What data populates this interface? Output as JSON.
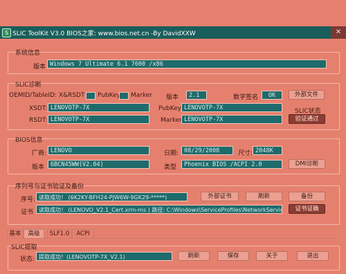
{
  "window": {
    "title": "SLIC ToolKit V3.0     BIOS之家: www.bios.net.cn  -By DavidXXW",
    "icon_text": "S",
    "close": "✕"
  },
  "system": {
    "group_title": "系统信息",
    "version_label": "版本",
    "version_value": "Windows 7 Ultimate 6.1 7600 /x86"
  },
  "slic": {
    "group_title": "SLIC诊断",
    "demid_label": "OEMID/TableID: X&RSDT",
    "pubkey_label": "PubKey",
    "marker_label": "Marker",
    "version_label": "版本",
    "version_value": "2.1",
    "signature_label": "数字签名",
    "signature_value": "OK",
    "external_file_button": "外部文件",
    "xsdt_label": "XSDT:",
    "xsdt_value": "LENOVOTP-7X",
    "pubkey2_label": "PubKey:",
    "pubkey2_value": "LENOVOTP-7X",
    "rsdt_label": "RSDT:",
    "rsdt_value": "LENOVOTP-7X",
    "marker2_label": "Marker:",
    "marker2_value": "LENOVOTP-7X",
    "status_label": "SLIC状态",
    "status_button": "验证通过"
  },
  "bios": {
    "group_title": "BIOS信息",
    "vendor_label": "厂商:",
    "vendor_value": "LENOVO",
    "date_label": "日期:",
    "date_value": "08/29/2008",
    "size_label": "尺寸:",
    "size_value": "2048K",
    "version_label": "版本",
    "version_value": "6BCN45WW(V2.04)",
    "type_label": "类型",
    "type_value": "Phoenix BIOS /ACPI 2.0",
    "dmi_button": "DMI诊断"
  },
  "serial": {
    "group_title": "序列号与证书验证及备份",
    "serial_label": "序号:",
    "serial_value": "读取成功！ (6K2KY-BFH24-PJW6W-9GK29-*****)",
    "external_cert_button": "外部证书",
    "refresh_button": "刷新",
    "backup_button": "备份",
    "cert_label": "证书",
    "cert_value": "读取成功！ (LENOVO_V2.1_Cert.xrm-ms )    路径: C:\\Windows\\ServiceProfiles\\NetworkService\\A",
    "cert_verify_button": "证书证确"
  },
  "tabs": [
    "基本",
    "高级",
    "SLF1.0",
    "ACPI"
  ],
  "extract": {
    "group_title": "SLIC提取",
    "status_label": "状态:",
    "status_value": "提取成功！(LENOVOTP-7X_V2.1)",
    "refresh_button": "刷新",
    "save_button": "保存",
    "about_button": "关于",
    "exit_button": "退出"
  },
  "colors": {
    "background": "#e6806e",
    "field": "#1f6b6c",
    "title_bar": "#1a5e5b",
    "accent_button": "#8c3d33"
  }
}
